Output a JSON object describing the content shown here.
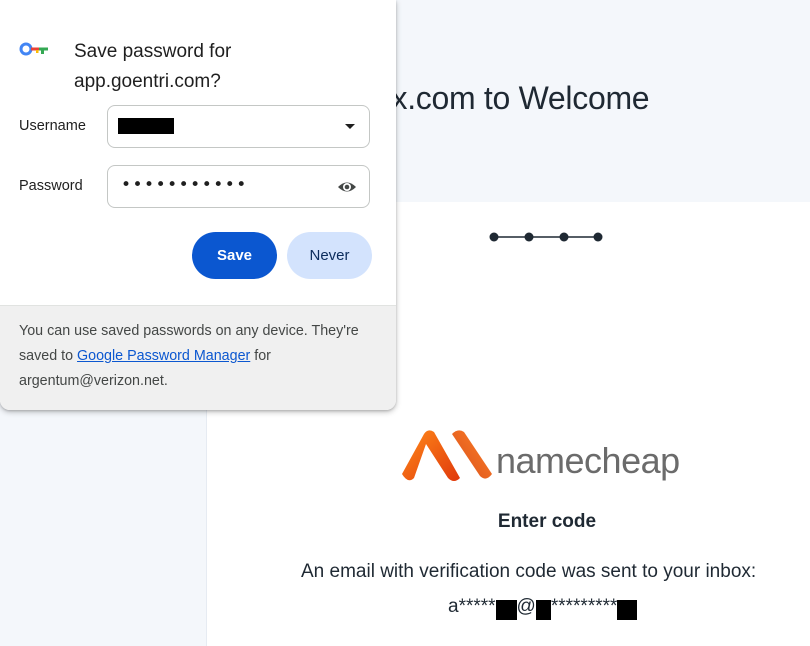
{
  "background_page": {
    "heading": "ux.com to Welcome",
    "logo_text": "namecheap",
    "enter_code_title": "Enter code",
    "email_note": "An email with verification code was sent to your inbox:",
    "masked_email": {
      "part1": "a*****",
      "part2": "@",
      "part3": "*********"
    }
  },
  "password_popup": {
    "title": "Save password for app.goentri.com?",
    "username_label": "Username",
    "username_value_redacted": true,
    "password_label": "Password",
    "password_value": "•••••••••••",
    "save_label": "Save",
    "never_label": "Never",
    "footer": {
      "text_before": "You can use saved passwords on any device. They're saved to ",
      "link_text": "Google Password Manager",
      "text_after": " for argentum@verizon.net."
    },
    "icons": {
      "key": "key-icon",
      "dropdown": "chevron-down-icon",
      "eye": "eye-icon"
    }
  },
  "colors": {
    "save_button": "#0b57d0",
    "never_button": "#d3e3fd",
    "namecheap_orange": "#ff6b00",
    "link": "#0b57d0"
  }
}
